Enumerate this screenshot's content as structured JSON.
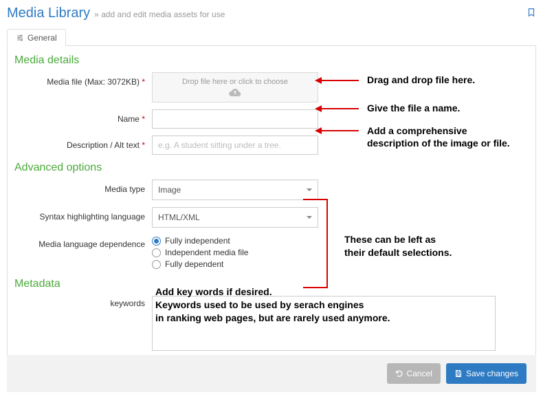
{
  "header": {
    "title": "Media Library",
    "subtitle": "add and edit media assets for use"
  },
  "tab": {
    "general": "General"
  },
  "sections": {
    "media_details": "Media details",
    "advanced": "Advanced options",
    "metadata": "Metadata"
  },
  "labels": {
    "media_file": "Media file (Max: 3072KB)",
    "name": "Name",
    "description": "Description / Alt text",
    "media_type": "Media type",
    "syntax": "Syntax highlighting language",
    "dependence": "Media language dependence",
    "keywords": "keywords"
  },
  "dropzone": {
    "text": "Drop file here or click to choose"
  },
  "placeholders": {
    "description": "e.g. A student sitting under a tree."
  },
  "selects": {
    "media_type": "Image",
    "syntax": "HTML/XML"
  },
  "radios": {
    "opt1": "Fully independent",
    "opt2": "Independent media file",
    "opt3": "Fully dependent",
    "selected": "opt1"
  },
  "buttons": {
    "cancel": "Cancel",
    "save": "Save changes"
  },
  "annotations": {
    "drop": "Drag and drop file here.",
    "name": "Give the file a name.",
    "desc": "Add a comprehensive\ndescription of the image or file.",
    "defaults": "These can be left as\ntheir default selections.",
    "keywords": "Add key words if desired.\nKeywords used to be used by serach engines\nin ranking web pages, but are rarely used anymore."
  }
}
